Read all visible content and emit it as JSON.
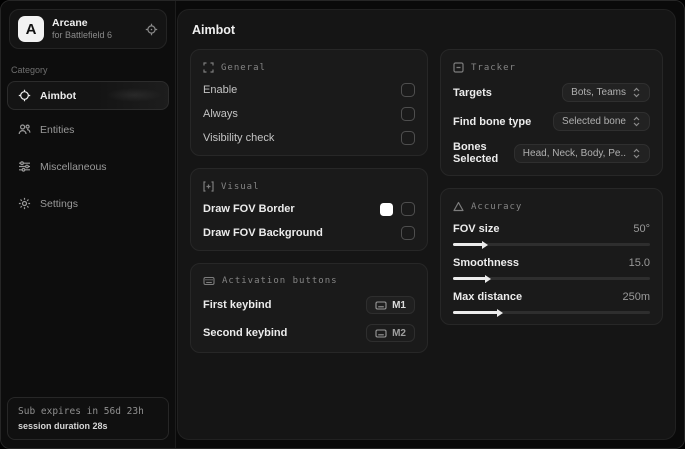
{
  "sidebar": {
    "logo_letter": "A",
    "app_name": "Arcane",
    "app_subtitle": "for Battlefield 6",
    "category_label": "Category",
    "items": [
      {
        "label": "Aimbot",
        "icon": "crosshair-icon",
        "active": true
      },
      {
        "label": "Entities",
        "icon": "entities-icon",
        "active": false
      },
      {
        "label": "Miscellaneous",
        "icon": "sliders-icon",
        "active": false
      },
      {
        "label": "Settings",
        "icon": "gear-icon",
        "active": false
      }
    ],
    "footer": {
      "expiry": "Sub expires in 56d 23h",
      "session": "session duration 28s"
    }
  },
  "main": {
    "title": "Aimbot",
    "general": {
      "header": "General",
      "rows": [
        {
          "label": "Enable",
          "checked": false
        },
        {
          "label": "Always",
          "checked": false
        },
        {
          "label": "Visibility check",
          "checked": false
        }
      ]
    },
    "visual": {
      "header": "Visual",
      "rows": [
        {
          "label": "Draw FOV Border",
          "swatch": "#ffffff",
          "checked": false
        },
        {
          "label": "Draw FOV Background",
          "checked": false
        }
      ]
    },
    "activation": {
      "header": "Activation buttons",
      "rows": [
        {
          "label": "First keybind",
          "key": "M1"
        },
        {
          "label": "Second keybind",
          "key": "M2"
        }
      ]
    },
    "tracker": {
      "header": "Tracker",
      "rows": [
        {
          "label": "Targets",
          "value": "Bots, Teams"
        },
        {
          "label": "Find bone type",
          "value": "Selected bone"
        },
        {
          "label": "Bones Selected",
          "value": "Head, Neck, Body, Pe.."
        }
      ]
    },
    "accuracy": {
      "header": "Accuracy",
      "rows": [
        {
          "label": "FOV size",
          "value": "50°",
          "fill_pct": 15
        },
        {
          "label": "Smoothness",
          "value": "15.0",
          "fill_pct": 17
        },
        {
          "label": "Max distance",
          "value": "250m",
          "fill_pct": 23
        }
      ]
    }
  },
  "colors": {
    "fov_border_swatch": "#ffffff",
    "slider_fill": "#ececec",
    "panel_bg": "#151515",
    "card_bg": "#1a1a1a"
  }
}
